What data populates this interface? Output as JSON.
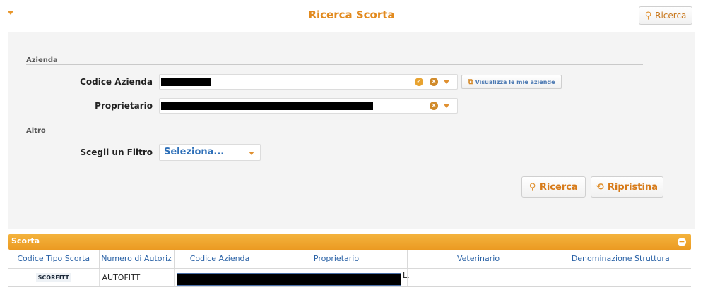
{
  "header": {
    "title": "Ricerca Scorta",
    "search_button": "Ricerca"
  },
  "form": {
    "section_company": "Azienda",
    "company_code_label": "Codice Azienda",
    "owner_label": "Proprietario",
    "view_companies_button": "Visualizza le mie aziende",
    "section_other": "Altro",
    "filter_label": "Scegli un Filtro",
    "filter_value": "Seleziona...",
    "search_button": "Ricerca",
    "reset_button": "Ripristina"
  },
  "results": {
    "title": "Scorta",
    "columns": [
      "Codice Tipo Scorta",
      "Numero di Autoriz",
      "Codice Azienda",
      "Proprietario",
      "Veterinario",
      "Denominazione Struttura"
    ],
    "rows": [
      {
        "code": "SCORFITT",
        "auth_number": "AUTOFITT",
        "company_code": "",
        "owner_suffix": "L.",
        "vet": "",
        "facility": ""
      }
    ]
  },
  "colors": {
    "accent": "#e28a1e",
    "results_bar": "#eb9a22",
    "link_blue": "#2a62a6"
  },
  "icons": {
    "collapse": "chevron-down-icon",
    "search": "magnifier-icon",
    "reset": "refresh-icon",
    "confirm": "check-circle-icon",
    "clear": "x-circle-icon",
    "external": "external-link-icon",
    "toggle": "minus-circle-icon"
  }
}
